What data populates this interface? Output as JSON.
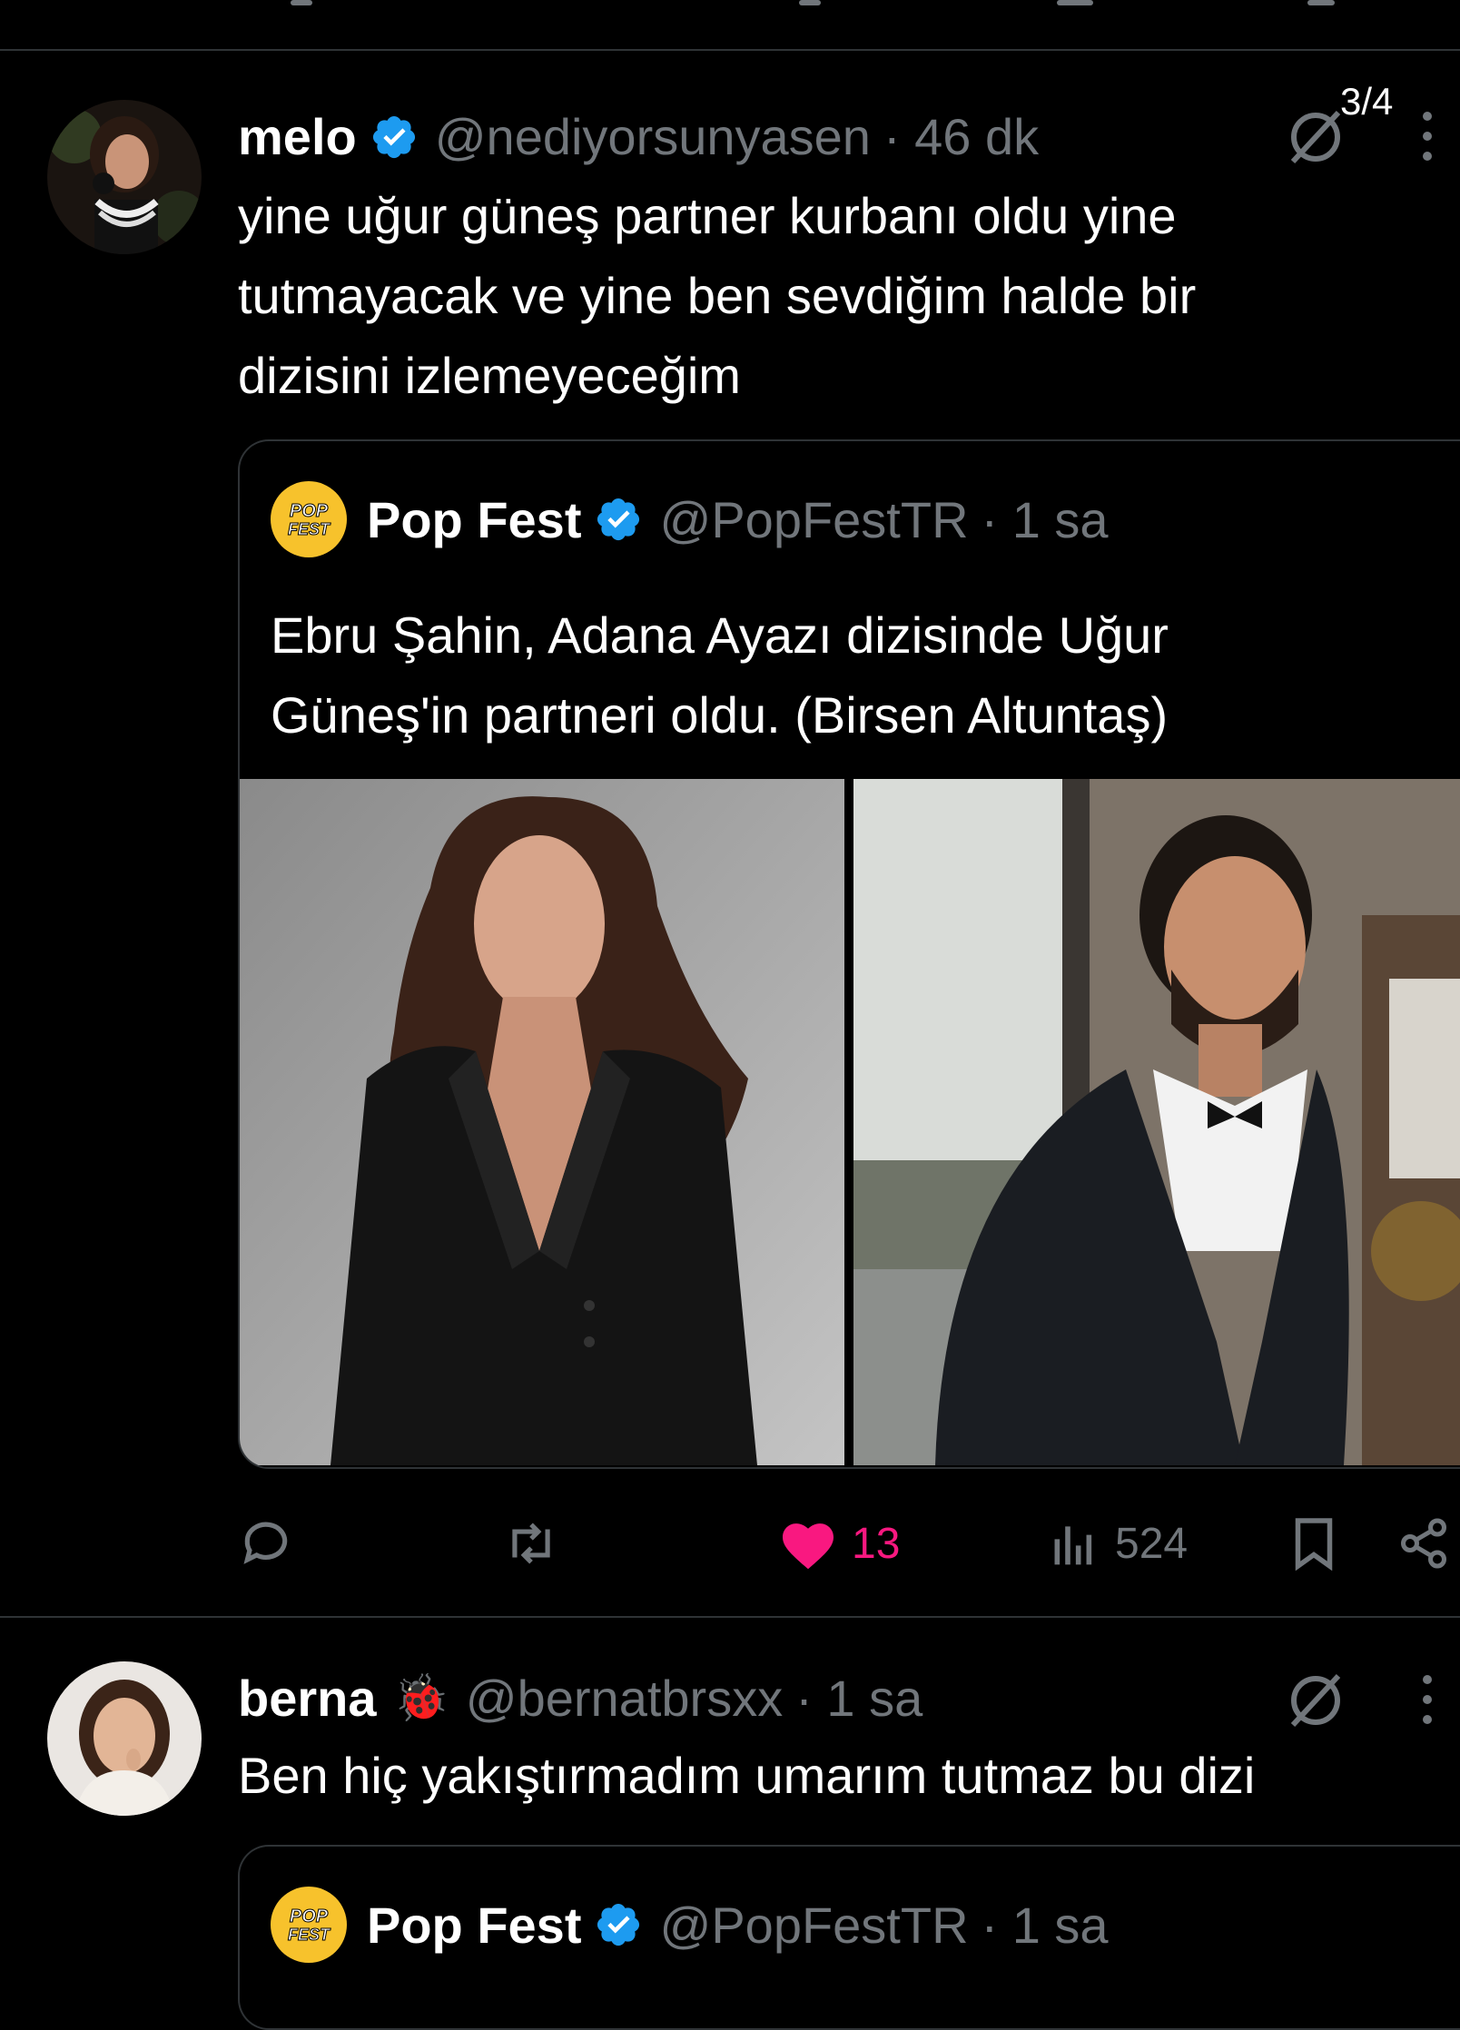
{
  "page_indicator": "3/4",
  "tweet1": {
    "name": "melo",
    "handle": "@nediyorsunyasen",
    "time": "· 46 dk",
    "lines": [
      "yine uğur güneş partner kurbanı oldu yine",
      "tutmayacak ve yine ben sevdiğim halde bir",
      "dizisini izlemeyeceğim"
    ],
    "quote": {
      "name": "Pop Fest",
      "handle": "@PopFestTR",
      "time": "· 1 sa",
      "logo_text": "POP FEST",
      "lines": [
        "Ebru Şahin, Adana Ayazı dizisinde Uğur",
        "Güneş'in partneri oldu. (Birsen Altuntaş)"
      ]
    },
    "actions": {
      "reply_count": "",
      "repost_count": "",
      "like_count": "13",
      "views_count": "524"
    }
  },
  "tweet2": {
    "name": "berna",
    "emoji": "🐞",
    "handle": "@bernatbrsxx",
    "time": "· 1 sa",
    "text": "Ben hiç yakıştırmadım umarım tutmaz bu dizi",
    "quote": {
      "name": "Pop Fest",
      "handle": "@PopFestTR",
      "time": "· 1 sa",
      "logo_text": "POP FEST"
    }
  },
  "colors": {
    "background": "#000000",
    "text": "#e7e9ea",
    "secondary": "#71767b",
    "border": "#2f3336",
    "verified": "#1d9bf0",
    "like": "#f91880",
    "popfest_yellow": "#f7c22c"
  },
  "icons": [
    "verified-badge-icon",
    "grok-icon",
    "more-icon",
    "reply-icon",
    "repost-icon",
    "like-icon",
    "views-icon",
    "bookmark-icon",
    "share-icon"
  ]
}
